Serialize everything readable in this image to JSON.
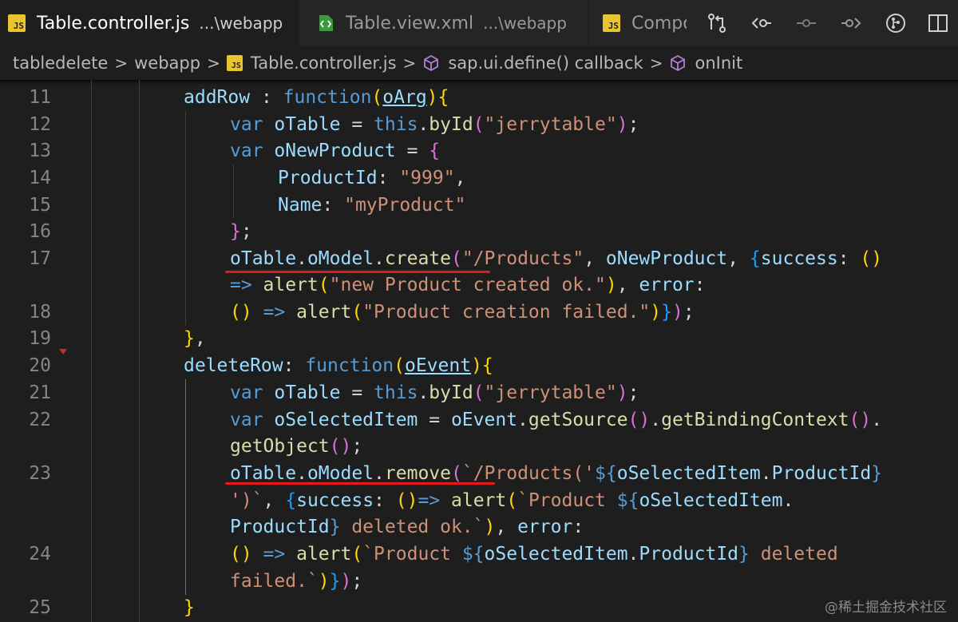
{
  "tabs": [
    {
      "title": "Table.controller.js",
      "path": "...\\webapp",
      "icon": "js-file-icon",
      "active": true
    },
    {
      "title": "Table.view.xml",
      "path": "...\\webapp",
      "icon": "xml-file-icon",
      "active": false
    },
    {
      "title": "Compone",
      "path": "",
      "icon": "js-file-icon",
      "active": false
    }
  ],
  "js_badge_text": "JS",
  "close_glyph": "✕",
  "toolbar_icons": [
    "git-compare-icon",
    "go-back-icon",
    "commit-dot-icon",
    "go-forward-icon",
    "source-control-icon",
    "split-editor-icon"
  ],
  "breadcrumb": {
    "items": [
      "tabledelete",
      "webapp",
      "Table.controller.js",
      "sap.ui.define() callback",
      "onInit"
    ],
    "separator": ">"
  },
  "editor": {
    "line_numbers": [
      "11",
      "12",
      "13",
      "14",
      "15",
      "16",
      "17",
      "",
      "18",
      "19",
      "20",
      "21",
      "22",
      "",
      "23",
      "",
      "",
      "24",
      "",
      "25"
    ],
    "lines": [
      [
        [
          "prop",
          "addRow"
        ],
        [
          "pn",
          " : "
        ],
        [
          "kw",
          "function"
        ],
        [
          "b1",
          "("
        ],
        [
          "param",
          "oArg"
        ],
        [
          "b1",
          ")"
        ],
        [
          "b1",
          "{"
        ]
      ],
      [
        [
          "kw",
          "var "
        ],
        [
          "var",
          "oTable"
        ],
        [
          "pn",
          " = "
        ],
        [
          "kw",
          "this"
        ],
        [
          "pn",
          "."
        ],
        [
          "fn",
          "byId"
        ],
        [
          "b2",
          "("
        ],
        [
          "str",
          "\"jerrytable\""
        ],
        [
          "b2",
          ")"
        ],
        [
          "pn",
          ";"
        ]
      ],
      [
        [
          "kw",
          "var "
        ],
        [
          "var",
          "oNewProduct"
        ],
        [
          "pn",
          " = "
        ],
        [
          "b2",
          "{"
        ]
      ],
      [
        [
          "prop",
          "ProductId"
        ],
        [
          "pn",
          ": "
        ],
        [
          "str",
          "\"999\""
        ],
        [
          "pn",
          ","
        ]
      ],
      [
        [
          "prop",
          "Name"
        ],
        [
          "pn",
          ": "
        ],
        [
          "str",
          "\"myProduct\""
        ]
      ],
      [
        [
          "b2",
          "}"
        ],
        [
          "pn",
          ";"
        ]
      ],
      [
        [
          "var",
          "oTable"
        ],
        [
          "pn",
          "."
        ],
        [
          "var",
          "oModel"
        ],
        [
          "pn",
          "."
        ],
        [
          "fn",
          "create"
        ],
        [
          "b2",
          "("
        ],
        [
          "str",
          "\"/Products\""
        ],
        [
          "pn",
          ", "
        ],
        [
          "var",
          "oNewProduct"
        ],
        [
          "pn",
          ", "
        ],
        [
          "b3",
          "{"
        ],
        [
          "prop",
          "success"
        ],
        [
          "pn",
          ": "
        ],
        [
          "b1",
          "()"
        ]
      ],
      [
        [
          "arrow",
          "=> "
        ],
        [
          "fn",
          "alert"
        ],
        [
          "b1",
          "("
        ],
        [
          "str",
          "\"new Product created ok.\""
        ],
        [
          "b1",
          ")"
        ],
        [
          "pn",
          ", "
        ],
        [
          "prop",
          "error"
        ],
        [
          "pn",
          ":"
        ]
      ],
      [
        [
          "b1",
          "()"
        ],
        [
          "arrow",
          " => "
        ],
        [
          "fn",
          "alert"
        ],
        [
          "b1",
          "("
        ],
        [
          "str",
          "\"Product creation failed.\""
        ],
        [
          "b1",
          ")"
        ],
        [
          "b3",
          "}"
        ],
        [
          "b2",
          ")"
        ],
        [
          "pn",
          ";"
        ]
      ],
      [
        [
          "b1",
          "}"
        ],
        [
          "pn",
          ","
        ]
      ],
      [
        [
          "prop",
          "deleteRow"
        ],
        [
          "pn",
          ": "
        ],
        [
          "kw",
          "function"
        ],
        [
          "b1",
          "("
        ],
        [
          "param",
          "oEvent"
        ],
        [
          "b1",
          ")"
        ],
        [
          "b1",
          "{"
        ]
      ],
      [
        [
          "kw",
          "var "
        ],
        [
          "var",
          "oTable"
        ],
        [
          "pn",
          " = "
        ],
        [
          "kw",
          "this"
        ],
        [
          "pn",
          "."
        ],
        [
          "fn",
          "byId"
        ],
        [
          "b2",
          "("
        ],
        [
          "str",
          "\"jerrytable\""
        ],
        [
          "b2",
          ")"
        ],
        [
          "pn",
          ";"
        ]
      ],
      [
        [
          "kw",
          "var "
        ],
        [
          "var",
          "oSelectedItem"
        ],
        [
          "pn",
          " = "
        ],
        [
          "var",
          "oEvent"
        ],
        [
          "pn",
          "."
        ],
        [
          "fn",
          "getSource"
        ],
        [
          "b2",
          "()"
        ],
        [
          "pn",
          "."
        ],
        [
          "fn",
          "getBindingContext"
        ],
        [
          "b2",
          "()"
        ],
        [
          "pn",
          "."
        ]
      ],
      [
        [
          "fn",
          "getObject"
        ],
        [
          "b2",
          "()"
        ],
        [
          "pn",
          ";"
        ]
      ],
      [
        [
          "var",
          "oTable"
        ],
        [
          "pn",
          "."
        ],
        [
          "var",
          "oModel"
        ],
        [
          "pn",
          "."
        ],
        [
          "fn",
          "remove"
        ],
        [
          "b2",
          "("
        ],
        [
          "tmpl",
          "`/Products('"
        ],
        [
          "kw",
          "${"
        ],
        [
          "var",
          "oSelectedItem"
        ],
        [
          "pn",
          "."
        ],
        [
          "var",
          "ProductId"
        ],
        [
          "kw",
          "}"
        ]
      ],
      [
        [
          "tmpl",
          "')`"
        ],
        [
          "pn",
          ", "
        ],
        [
          "b3",
          "{"
        ],
        [
          "prop",
          "success"
        ],
        [
          "pn",
          ": "
        ],
        [
          "b1",
          "()"
        ],
        [
          "arrow",
          "=> "
        ],
        [
          "fn",
          "alert"
        ],
        [
          "b1",
          "("
        ],
        [
          "tmpl",
          "`Product "
        ],
        [
          "kw",
          "${"
        ],
        [
          "var",
          "oSelectedItem"
        ],
        [
          "pn",
          "."
        ]
      ],
      [
        [
          "var",
          "ProductId"
        ],
        [
          "kw",
          "}"
        ],
        [
          "tmpl",
          " deleted ok.`"
        ],
        [
          "b1",
          ")"
        ],
        [
          "pn",
          ", "
        ],
        [
          "prop",
          "error"
        ],
        [
          "pn",
          ":"
        ]
      ],
      [
        [
          "b1",
          "()"
        ],
        [
          "arrow",
          " => "
        ],
        [
          "fn",
          "alert"
        ],
        [
          "b1",
          "("
        ],
        [
          "tmpl",
          "`Product "
        ],
        [
          "kw",
          "${"
        ],
        [
          "var",
          "oSelectedItem"
        ],
        [
          "pn",
          "."
        ],
        [
          "var",
          "ProductId"
        ],
        [
          "kw",
          "}"
        ],
        [
          "tmpl",
          " deleted"
        ]
      ],
      [
        [
          "tmpl",
          "failed.`"
        ],
        [
          "b1",
          ")"
        ],
        [
          "b3",
          "}"
        ],
        [
          "b2",
          ")"
        ],
        [
          "pn",
          ";"
        ]
      ],
      [
        [
          "b1",
          "}"
        ]
      ]
    ]
  },
  "watermark": "@稀土掘金技术社区",
  "colors": {
    "editor_bg": "#1e1e1e",
    "tabbar_bg": "#252526",
    "keyword": "#569cd6",
    "function": "#dcdcaa",
    "variable": "#9cdcfe",
    "string": "#ce9178",
    "annotation_underline": "#e51919"
  }
}
